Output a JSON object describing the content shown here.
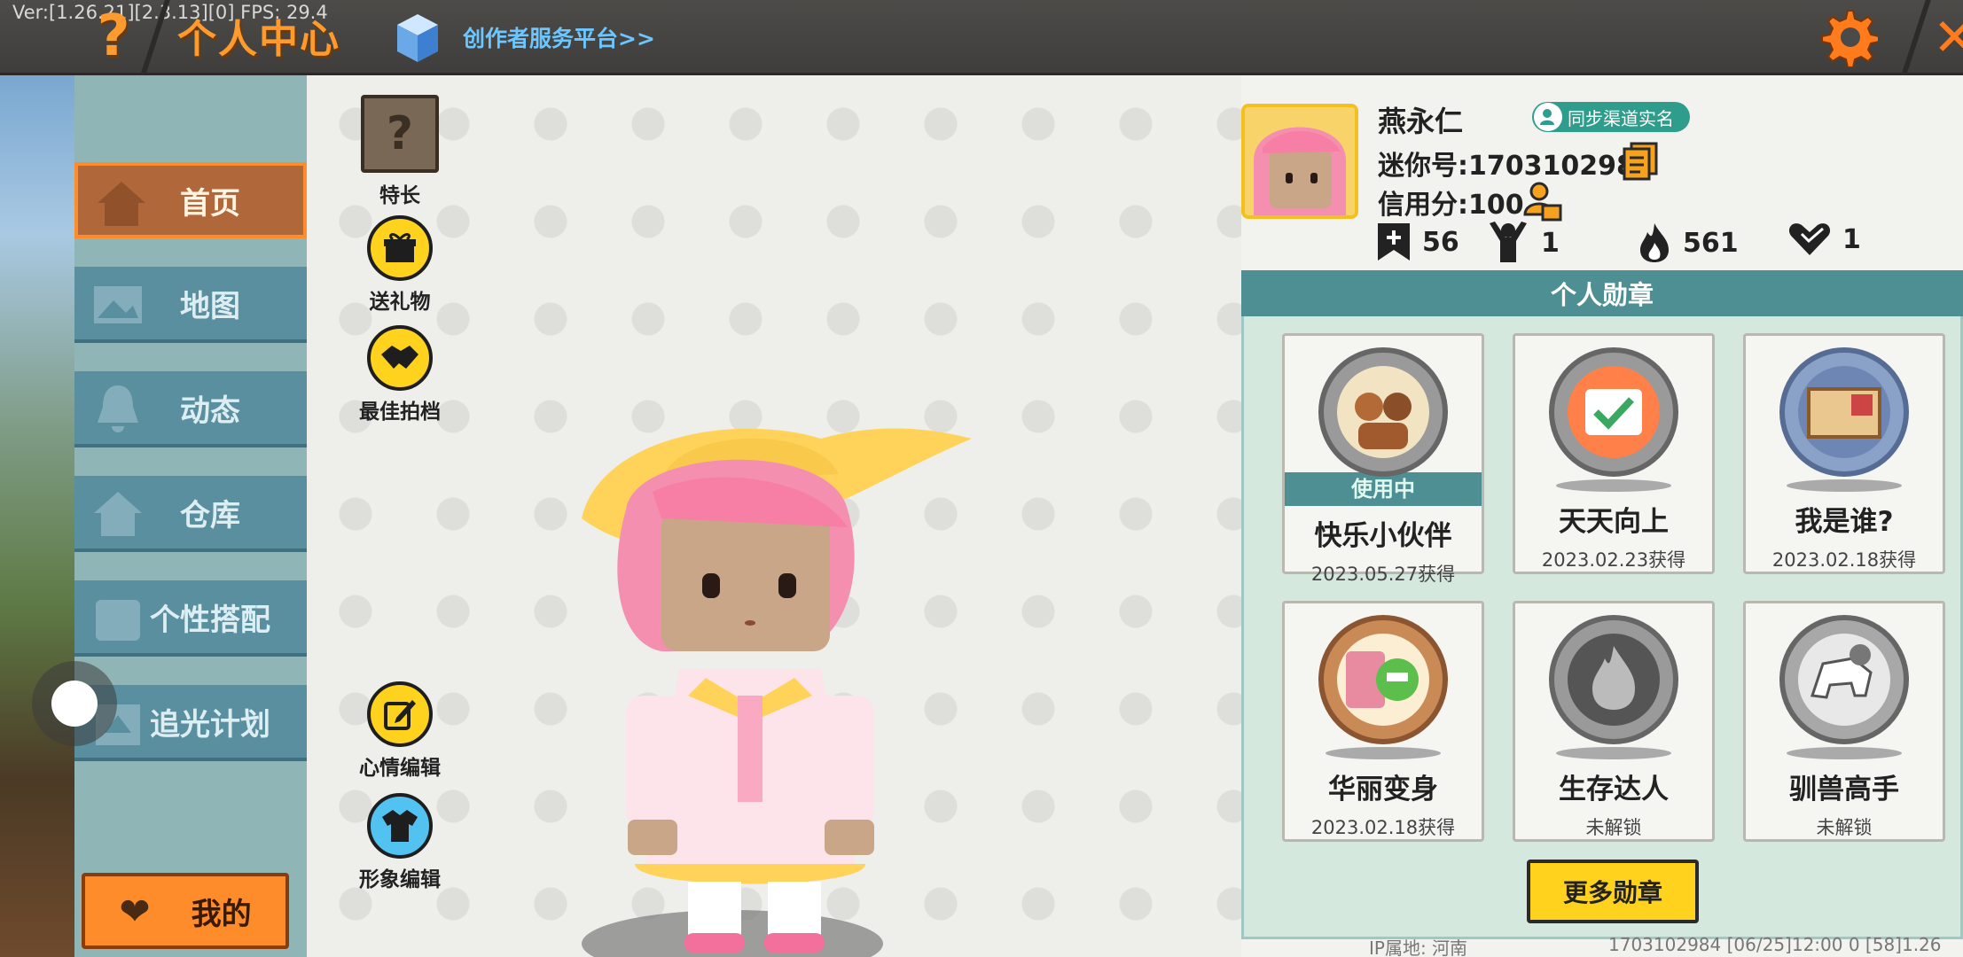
{
  "debug": {
    "version_text": "Ver:[1.26.21][2.3.13][0] FPS: 29.4"
  },
  "header": {
    "help_label": "?",
    "title": "个人中心",
    "creator_link": "创作者服务平台>>"
  },
  "sidebar": {
    "items": [
      {
        "label": "首页",
        "icon": "home-icon",
        "active": true
      },
      {
        "label": "地图",
        "icon": "map-icon",
        "active": false
      },
      {
        "label": "动态",
        "icon": "bell-icon",
        "active": false
      },
      {
        "label": "仓库",
        "icon": "house-icon",
        "active": false
      },
      {
        "label": "个性搭配",
        "icon": "outfit-icon",
        "active": false
      },
      {
        "label": "追光计划",
        "icon": "plan-icon",
        "active": false
      }
    ],
    "my_button": "我的"
  },
  "actions": {
    "specialty": "特长",
    "gift": "送礼物",
    "best_shot": "最佳拍档",
    "mood_edit": "心情编辑",
    "avatar_edit": "形象编辑"
  },
  "profile": {
    "name": "燕永仁",
    "sync_badge": "同步渠道实名",
    "mini_id": "迷你号:1703102984",
    "credit": "信用分:100",
    "stats": {
      "followers": "56",
      "fans": "1",
      "heat": "561",
      "likes": "1"
    }
  },
  "medals": {
    "header": "个人勋章",
    "in_use_label": "使用中",
    "items": [
      {
        "name": "快乐小伙伴",
        "status": "2023.05.27获得",
        "in_use": true
      },
      {
        "name": "天天向上",
        "status": "2023.02.23获得",
        "in_use": false
      },
      {
        "name": "我是谁?",
        "status": "2023.02.18获得",
        "in_use": false
      },
      {
        "name": "华丽变身",
        "status": "2023.02.18获得",
        "in_use": false
      },
      {
        "name": "生存达人",
        "status": "未解锁",
        "in_use": false
      },
      {
        "name": "驯兽高手",
        "status": "未解锁",
        "in_use": false
      }
    ],
    "more_button": "更多勋章"
  },
  "footer": {
    "ip_location": "IP属地: 河南",
    "id_info": "1703102984   [06/25]12:00 0  [58]1.26"
  },
  "colors": {
    "accent_orange": "#ff8c2a",
    "teal": "#4e8f93",
    "yellow": "#ffd21e"
  }
}
